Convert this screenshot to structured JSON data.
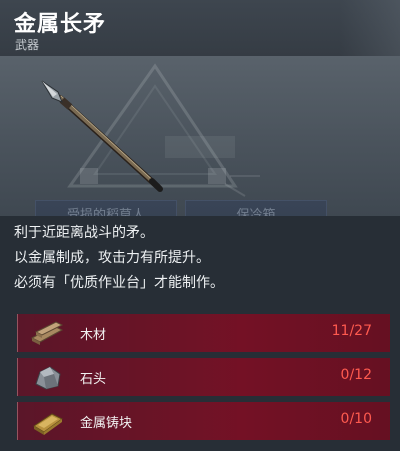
{
  "item": {
    "title": "金属长矛",
    "category": "武器",
    "description": [
      "利于近距离战斗的矛。",
      "以金属制成，攻击力有所提升。",
      "必须有「优质作业台」才能制作。"
    ]
  },
  "background_ui": {
    "left_button": "受损的稻草人",
    "right_button": "保冷箱"
  },
  "materials": [
    {
      "icon": "wood-icon",
      "name": "木材",
      "count": "11/27"
    },
    {
      "icon": "stone-icon",
      "name": "石头",
      "count": "0/12"
    },
    {
      "icon": "metal-ingot-icon",
      "name": "金属铸块",
      "count": "0/10"
    }
  ],
  "colors": {
    "header": "#3e464f",
    "panel": "#272e36",
    "requirement_row": "#78102a",
    "insufficient_count": "#ff5a4f"
  }
}
